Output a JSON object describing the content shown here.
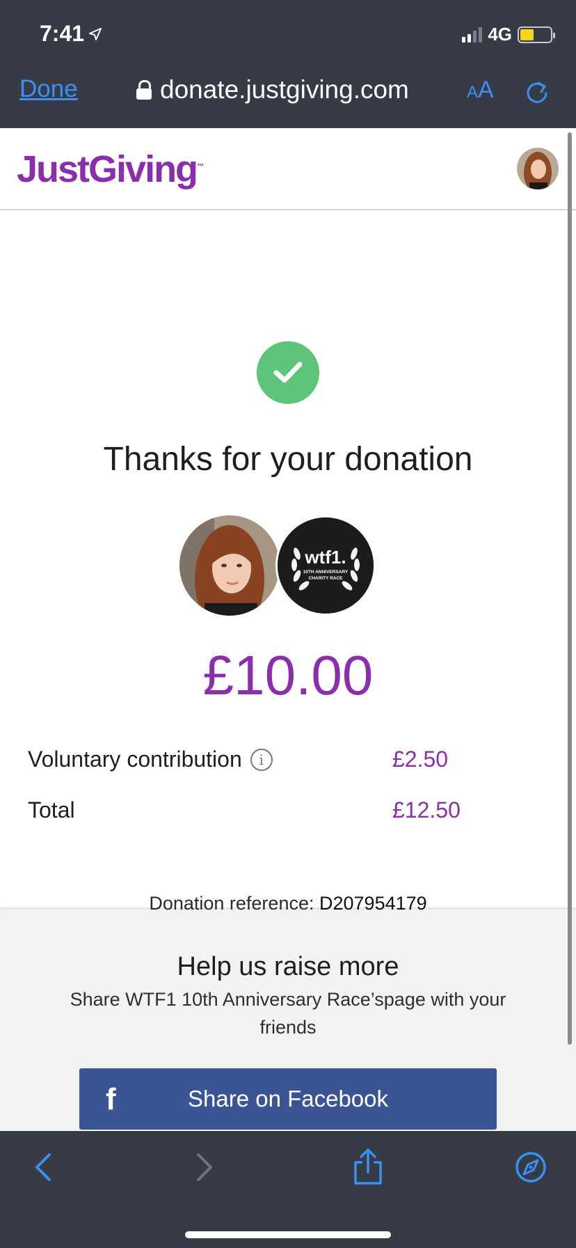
{
  "status_bar": {
    "time": "7:41",
    "network": "4G",
    "battery_level": 0.45,
    "battery_color": "#f7d51d"
  },
  "browser": {
    "done_label": "Done",
    "url": "donate.justgiving.com",
    "text_size_label_small": "A",
    "text_size_label_large": "A",
    "accent_color": "#3b8ff5"
  },
  "header": {
    "logo_text": "JustGiving",
    "logo_tm": "™",
    "brand_color": "#8b2eac"
  },
  "confirmation": {
    "title": "Thanks for your donation",
    "amount": "£10.00",
    "charity_logo_text": "wtf1.",
    "charity_logo_subtext_1": "10TH ANNIVERSARY",
    "charity_logo_subtext_2": "CHARITY RACE",
    "rows": [
      {
        "label": "Voluntary contribution",
        "value": "£2.50"
      },
      {
        "label": "Total",
        "value": "£12.50"
      }
    ],
    "info_icon": "info-icon",
    "reference_label": "Donation reference:",
    "reference_code": "D207954179"
  },
  "share": {
    "title": "Help us raise more",
    "subtitle": "Share WTF1 10th Anniversary Race’spage with your friends",
    "facebook_label": "Share on Facebook",
    "facebook_color": "#3b5594"
  },
  "toolbar": {
    "icons": [
      "back-icon",
      "forward-icon",
      "share-icon",
      "compass-icon"
    ]
  }
}
